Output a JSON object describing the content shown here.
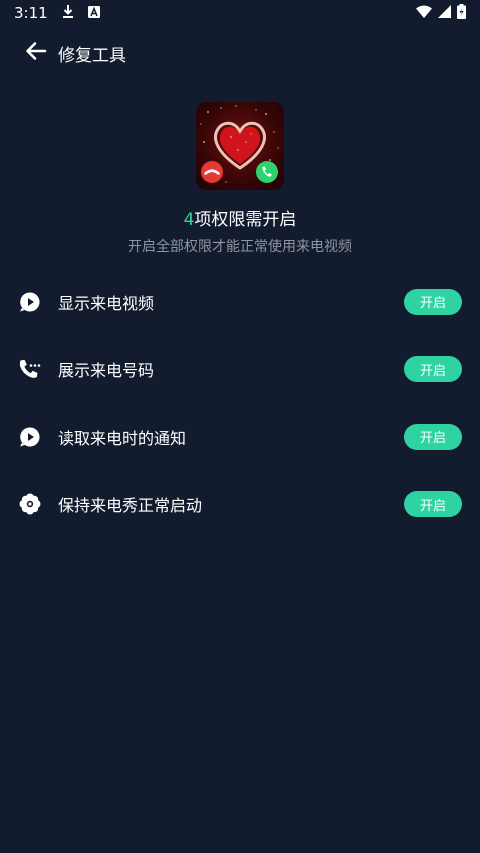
{
  "status_bar": {
    "time": "3:11",
    "icons": [
      "download-icon",
      "notification-a-icon",
      "wifi-icon",
      "signal-icon",
      "battery-icon"
    ]
  },
  "header": {
    "title": "修复工具",
    "back_icon": "back-arrow-icon"
  },
  "summary": {
    "count": "4",
    "count_suffix": "项权限需开启",
    "subtitle": "开启全部权限才能正常使用来电视频",
    "accent_color": "#2fd3a2"
  },
  "permissions": [
    {
      "icon": "video-play-icon",
      "label": "显示来电视频",
      "button": "开启"
    },
    {
      "icon": "phone-dots-icon",
      "label": "展示来电号码",
      "button": "开启"
    },
    {
      "icon": "notification-play-icon",
      "label": "读取来电时的通知",
      "button": "开启"
    },
    {
      "icon": "flower-gear-icon",
      "label": "保持来电秀正常启动",
      "button": "开启"
    }
  ]
}
